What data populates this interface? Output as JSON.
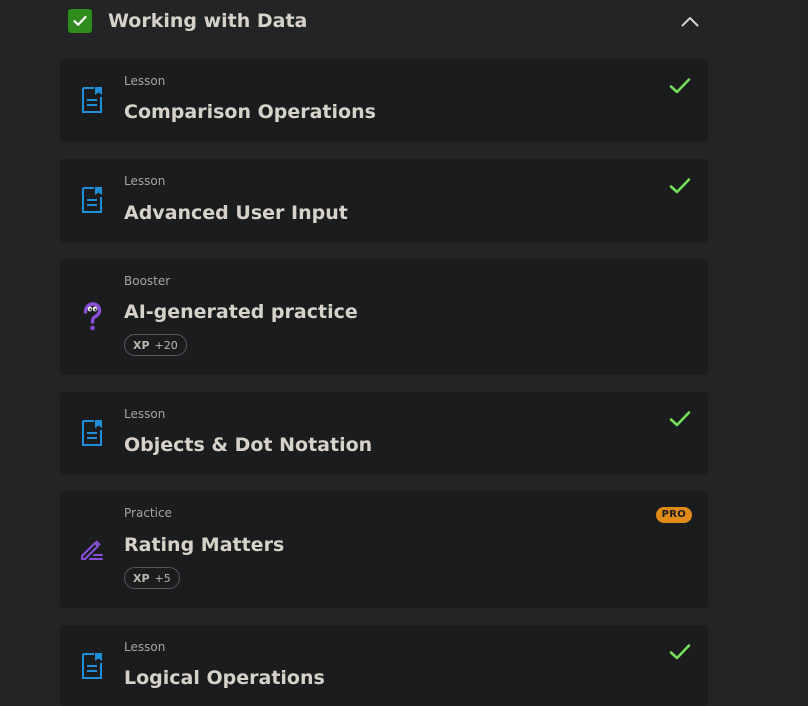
{
  "section": {
    "title": "Working with Data",
    "completed": true,
    "icons": {
      "check": "checkbox-checked-icon",
      "collapse": "chevron-up-icon"
    }
  },
  "colors": {
    "background": "#232426",
    "card": "#1b1c1e",
    "section_check_bg": "#2e8b1c",
    "completed_check": "#74e05a",
    "lesson_icon": "#1e8fd8",
    "booster_icon": "#8a4fd8",
    "practice_icon": "#8a4fd8",
    "pro_badge": "#e08a17"
  },
  "items": [
    {
      "type": "Lesson",
      "title": "Comparison Operations",
      "icon": "lesson-document-icon",
      "completed": true
    },
    {
      "type": "Lesson",
      "title": "Advanced User Input",
      "icon": "lesson-document-icon",
      "completed": true
    },
    {
      "type": "Booster",
      "title": "AI-generated practice",
      "icon": "question-mark-icon",
      "completed": false,
      "xp_label": "XP",
      "xp_value": "+20"
    },
    {
      "type": "Lesson",
      "title": "Objects & Dot Notation",
      "icon": "lesson-document-icon",
      "completed": true
    },
    {
      "type": "Practice",
      "title": "Rating Matters",
      "icon": "pencil-edit-icon",
      "completed": false,
      "xp_label": "XP",
      "xp_value": "+5",
      "badge": "PRO"
    },
    {
      "type": "Lesson",
      "title": "Logical Operations",
      "icon": "lesson-document-icon",
      "completed": true
    }
  ]
}
